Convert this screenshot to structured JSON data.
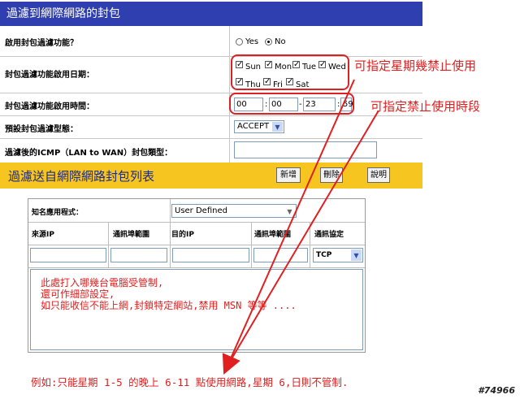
{
  "header": {
    "title": "過濾到網際網路的封包"
  },
  "settings": {
    "enable": {
      "label": "啟用封包過濾功能？",
      "yes": "Yes",
      "no": "No"
    },
    "days": {
      "label": "封包過濾功能啟用日期：",
      "items": [
        {
          "name": "Sun",
          "checked": true
        },
        {
          "name": "Mon",
          "checked": true
        },
        {
          "name": "Tue",
          "checked": true
        },
        {
          "name": "Wed",
          "checked": true
        },
        {
          "name": "Thu",
          "checked": true
        },
        {
          "name": "Fri",
          "checked": true
        },
        {
          "name": "Sat",
          "checked": true
        }
      ]
    },
    "time": {
      "label": "封包過濾功能啟用時間：",
      "values": [
        "00",
        "00",
        "23",
        "59"
      ],
      "sep1": ":",
      "sep2": "-",
      "sep3": ":"
    },
    "policy": {
      "label": "預設封包過濾型態：",
      "value": "ACCEPT"
    },
    "icmp": {
      "label": "過濾後的ICMP（LAN to WAN）封包類型：",
      "value": ""
    }
  },
  "annotations": {
    "days_note": "可指定星期幾禁止使用",
    "time_note": "可指定禁止使用時段",
    "panel_note_lines": [
      "此處打入哪幾台電腦受管制,",
      "還可作細部設定,",
      "如只能收信不能上網,封鎖特定網站,禁用 MSN 等等 ...."
    ],
    "bottom_note": "例如:只能星期 1-5 的晚上 6-11 點使用網路,星期 6,日則不管制."
  },
  "list_bar": {
    "title": "過濾送自網際網路封包列表",
    "add": "新增",
    "delete": "刪除",
    "help": "說明"
  },
  "panel": {
    "app_label": "知名應用程式：",
    "app_value": "User Defined",
    "columns": [
      "來源IP",
      "通訊埠範圍",
      "目的IP",
      "通訊埠範圍",
      "通訊協定"
    ],
    "protocol": "TCP"
  },
  "watermark": "#74966",
  "colors": {
    "header_bg": "#2f3fb0",
    "bar_bg": "#f7c520",
    "annotation": "#e02020"
  }
}
